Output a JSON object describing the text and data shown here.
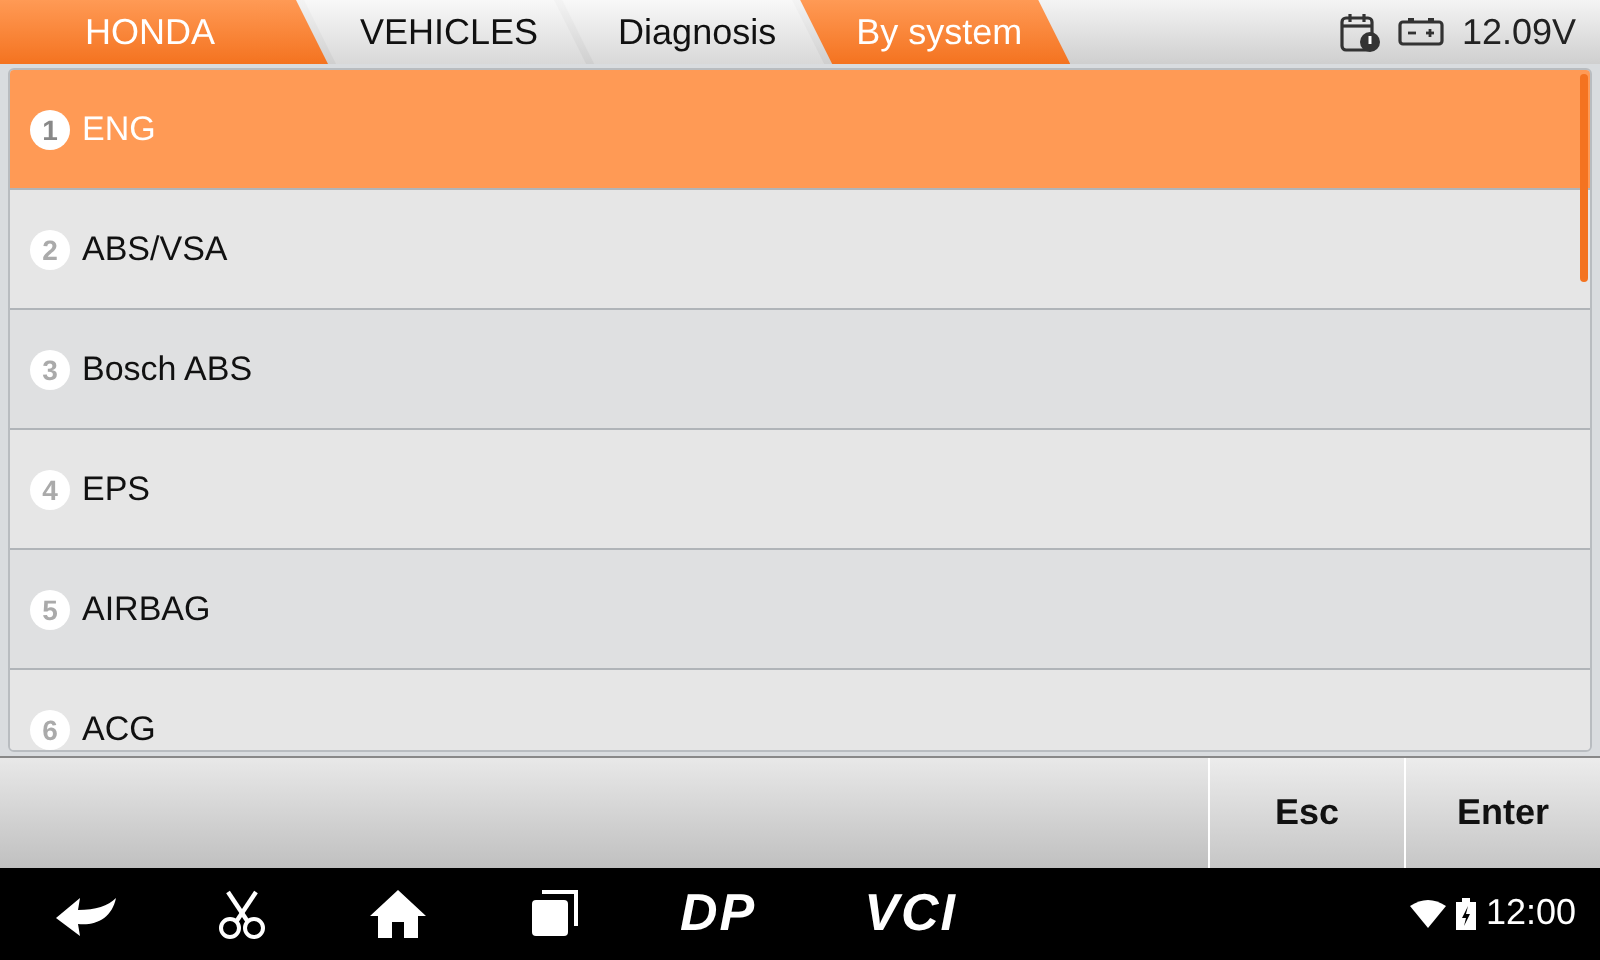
{
  "breadcrumbs": [
    {
      "label": "HONDA",
      "highlighted": true
    },
    {
      "label": "VEHICLES",
      "highlighted": false
    },
    {
      "label": "Diagnosis",
      "highlighted": false
    },
    {
      "label": "By system",
      "highlighted": true
    }
  ],
  "status": {
    "voltage": "12.09V"
  },
  "systems": [
    {
      "number": "1",
      "label": "ENG",
      "selected": true
    },
    {
      "number": "2",
      "label": "ABS/VSA",
      "selected": false
    },
    {
      "number": "3",
      "label": "Bosch ABS",
      "selected": false
    },
    {
      "number": "4",
      "label": "EPS",
      "selected": false
    },
    {
      "number": "5",
      "label": "AIRBAG",
      "selected": false
    },
    {
      "number": "6",
      "label": "ACG",
      "selected": false
    }
  ],
  "buttons": [
    "Esc",
    "Enter"
  ],
  "navbar": {
    "dp_label": "DP",
    "vci_label": "VCI",
    "time": "12:00"
  }
}
